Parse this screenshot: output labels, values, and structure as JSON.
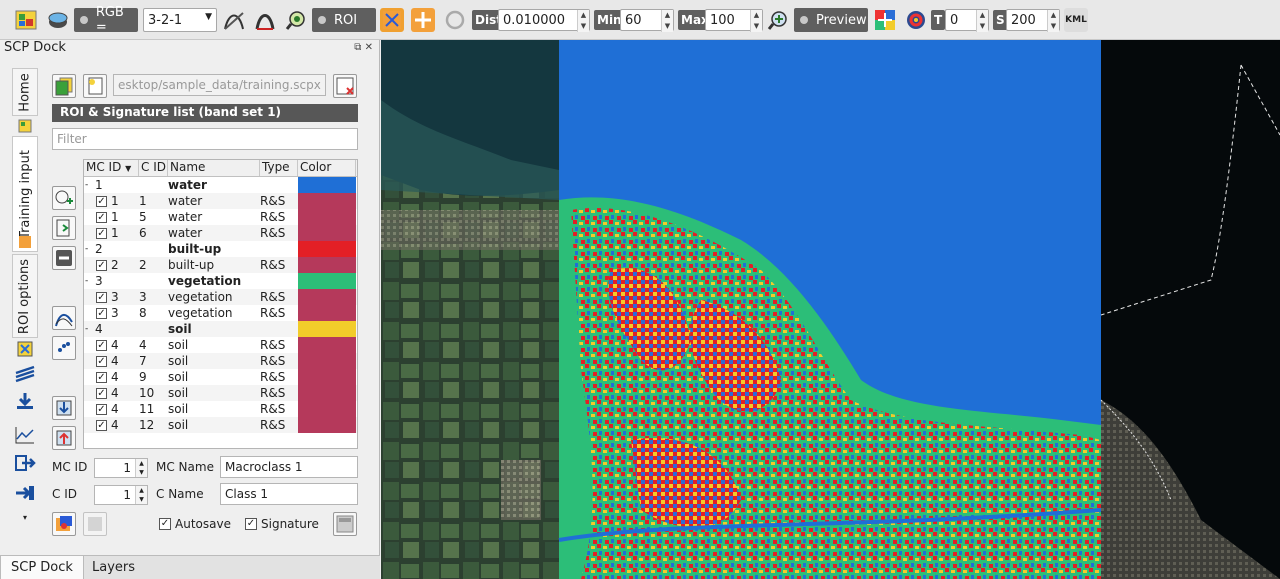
{
  "toolbar": {
    "rgb_label": "RGB =",
    "rgb_value": "3-2-1",
    "roi_label": "ROI",
    "dist_label": "Dist",
    "dist_value": "0.010000",
    "min_label": "Min",
    "min_value": "60",
    "max_label": "Max",
    "max_value": "100",
    "preview_label": "Preview",
    "t_label": "T",
    "t_value": "0",
    "s_label": "S",
    "s_value": "200",
    "kml_label": "KML"
  },
  "dock": {
    "title": "SCP Dock",
    "vertical_tabs": [
      "Home",
      "Training input",
      "ROI options"
    ],
    "training_path": "esktop/sample_data/training.scpx",
    "list_title": "ROI & Signature list (band set 1)",
    "filter_placeholder": "Filter",
    "columns": [
      "MC ID",
      "C ID",
      "Name",
      "Type",
      "Color"
    ],
    "rows": [
      {
        "kind": "macro",
        "mc": "1",
        "cid": "",
        "name": "water",
        "type": "",
        "color": "#1f6fd6"
      },
      {
        "kind": "class",
        "mc": "1",
        "cid": "1",
        "name": "water",
        "type": "R&S",
        "color": "#b5395b"
      },
      {
        "kind": "class",
        "mc": "1",
        "cid": "5",
        "name": "water",
        "type": "R&S",
        "color": "#b5395b"
      },
      {
        "kind": "class",
        "mc": "1",
        "cid": "6",
        "name": "water",
        "type": "R&S",
        "color": "#b5395b"
      },
      {
        "kind": "macro",
        "mc": "2",
        "cid": "",
        "name": "built-up",
        "type": "",
        "color": "#e31f26"
      },
      {
        "kind": "class",
        "mc": "2",
        "cid": "2",
        "name": "built-up",
        "type": "R&S",
        "color": "#b5395b"
      },
      {
        "kind": "macro",
        "mc": "3",
        "cid": "",
        "name": "vegetation",
        "type": "",
        "color": "#2cbe78"
      },
      {
        "kind": "class",
        "mc": "3",
        "cid": "3",
        "name": "vegetation",
        "type": "R&S",
        "color": "#b5395b"
      },
      {
        "kind": "class",
        "mc": "3",
        "cid": "8",
        "name": "vegetation",
        "type": "R&S",
        "color": "#b5395b"
      },
      {
        "kind": "macro",
        "mc": "4",
        "cid": "",
        "name": "soil",
        "type": "",
        "color": "#f2cc2a"
      },
      {
        "kind": "class",
        "mc": "4",
        "cid": "4",
        "name": "soil",
        "type": "R&S",
        "color": "#b5395b"
      },
      {
        "kind": "class",
        "mc": "4",
        "cid": "7",
        "name": "soil",
        "type": "R&S",
        "color": "#b5395b"
      },
      {
        "kind": "class",
        "mc": "4",
        "cid": "9",
        "name": "soil",
        "type": "R&S",
        "color": "#b5395b"
      },
      {
        "kind": "class",
        "mc": "4",
        "cid": "10",
        "name": "soil",
        "type": "R&S",
        "color": "#b5395b"
      },
      {
        "kind": "class",
        "mc": "4",
        "cid": "11",
        "name": "soil",
        "type": "R&S",
        "color": "#b5395b"
      },
      {
        "kind": "class",
        "mc": "4",
        "cid": "12",
        "name": "soil",
        "type": "R&S",
        "color": "#b5395b"
      }
    ],
    "mc_id_label": "MC ID",
    "mc_id_value": "1",
    "mc_name_label": "MC Name",
    "mc_name_value": "Macroclass 1",
    "c_id_label": "C ID",
    "c_id_value": "1",
    "c_name_label": "C Name",
    "c_name_value": "Class 1",
    "autosave_label": "Autosave",
    "signature_label": "Signature",
    "bottom_tabs": [
      "SCP Dock",
      "Layers"
    ]
  },
  "colors": {
    "water": "#1f6fd6",
    "builtup": "#e31f26",
    "vegetation": "#2cbe78",
    "soil": "#f2cc2a"
  }
}
